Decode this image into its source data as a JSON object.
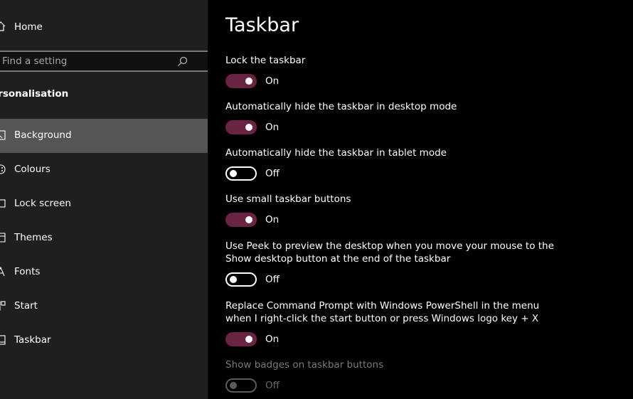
{
  "sidebar": {
    "home_label": "Home",
    "search_placeholder": "Find a setting",
    "section_title": "ersonalisation",
    "items": [
      {
        "label": "Background",
        "icon": "picture-icon",
        "selected": true
      },
      {
        "label": "Colours",
        "icon": "palette-icon",
        "selected": false
      },
      {
        "label": "Lock screen",
        "icon": "lock-screen-icon",
        "selected": false
      },
      {
        "label": "Themes",
        "icon": "themes-icon",
        "selected": false
      },
      {
        "label": "Fonts",
        "icon": "fonts-icon",
        "selected": false
      },
      {
        "label": "Start",
        "icon": "start-icon",
        "selected": false
      },
      {
        "label": "Taskbar",
        "icon": "taskbar-icon",
        "selected": false
      }
    ]
  },
  "main": {
    "title": "Taskbar",
    "settings": [
      {
        "label": "Lock the taskbar",
        "state": "On",
        "enabled": true
      },
      {
        "label": "Automatically hide the taskbar in desktop mode",
        "state": "On",
        "enabled": true
      },
      {
        "label": "Automatically hide the taskbar in tablet mode",
        "state": "Off",
        "enabled": true
      },
      {
        "label": "Use small taskbar buttons",
        "state": "On",
        "enabled": true
      },
      {
        "label": "Use Peek to preview the desktop when you move your mouse to the\nShow desktop button at the end of the taskbar",
        "state": "Off",
        "enabled": true
      },
      {
        "label": "Replace Command Prompt with Windows PowerShell in the menu\nwhen I right-click the start button or press Windows logo key + X",
        "state": "On",
        "enabled": true
      },
      {
        "label": "Show badges on taskbar buttons",
        "state": "Off",
        "enabled": false
      }
    ]
  },
  "colors": {
    "accent": "#6b2343",
    "sidebar_bg": "#1f1f1f",
    "selected_bg": "#555555",
    "main_bg": "#000000"
  }
}
